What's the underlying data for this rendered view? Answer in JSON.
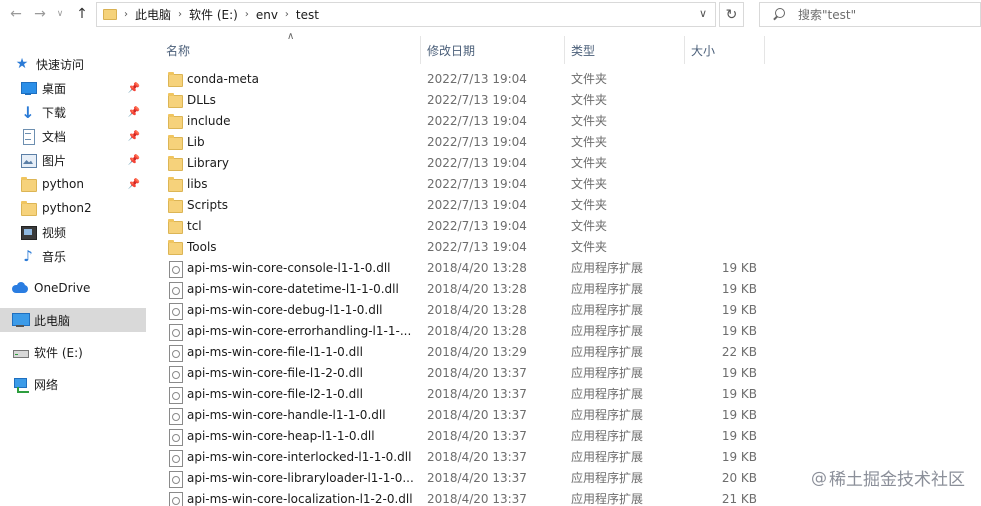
{
  "address": {
    "crumbs": [
      "此电脑",
      "软件 (E:)",
      "env",
      "test"
    ]
  },
  "search": {
    "placeholder": "搜索\"test\""
  },
  "sidebar": {
    "items": [
      {
        "label": "快速访问",
        "icon": "star-icon"
      },
      {
        "label": "桌面",
        "icon": "desktop-icon"
      },
      {
        "label": "下载",
        "icon": "download-icon"
      },
      {
        "label": "文档",
        "icon": "document-icon"
      },
      {
        "label": "图片",
        "icon": "picture-icon"
      },
      {
        "label": "python",
        "icon": "folder-icon"
      },
      {
        "label": "python2",
        "icon": "folder-icon"
      },
      {
        "label": "视频",
        "icon": "video-icon"
      },
      {
        "label": "音乐",
        "icon": "music-icon"
      },
      {
        "label": "OneDrive",
        "icon": "cloud-icon"
      },
      {
        "label": "此电脑",
        "icon": "computer-icon"
      },
      {
        "label": "软件 (E:)",
        "icon": "drive-icon"
      },
      {
        "label": "网络",
        "icon": "network-icon"
      }
    ]
  },
  "columns": {
    "name": "名称",
    "date": "修改日期",
    "type": "类型",
    "size": "大小"
  },
  "files": [
    {
      "name": "conda-meta",
      "date": "2022/7/13 19:04",
      "type": "文件夹",
      "size": "",
      "kind": "folder"
    },
    {
      "name": "DLLs",
      "date": "2022/7/13 19:04",
      "type": "文件夹",
      "size": "",
      "kind": "folder"
    },
    {
      "name": "include",
      "date": "2022/7/13 19:04",
      "type": "文件夹",
      "size": "",
      "kind": "folder"
    },
    {
      "name": "Lib",
      "date": "2022/7/13 19:04",
      "type": "文件夹",
      "size": "",
      "kind": "folder"
    },
    {
      "name": "Library",
      "date": "2022/7/13 19:04",
      "type": "文件夹",
      "size": "",
      "kind": "folder"
    },
    {
      "name": "libs",
      "date": "2022/7/13 19:04",
      "type": "文件夹",
      "size": "",
      "kind": "folder"
    },
    {
      "name": "Scripts",
      "date": "2022/7/13 19:04",
      "type": "文件夹",
      "size": "",
      "kind": "folder"
    },
    {
      "name": "tcl",
      "date": "2022/7/13 19:04",
      "type": "文件夹",
      "size": "",
      "kind": "folder"
    },
    {
      "name": "Tools",
      "date": "2022/7/13 19:04",
      "type": "文件夹",
      "size": "",
      "kind": "folder"
    },
    {
      "name": "api-ms-win-core-console-l1-1-0.dll",
      "date": "2018/4/20 13:28",
      "type": "应用程序扩展",
      "size": "19 KB",
      "kind": "dll"
    },
    {
      "name": "api-ms-win-core-datetime-l1-1-0.dll",
      "date": "2018/4/20 13:28",
      "type": "应用程序扩展",
      "size": "19 KB",
      "kind": "dll"
    },
    {
      "name": "api-ms-win-core-debug-l1-1-0.dll",
      "date": "2018/4/20 13:28",
      "type": "应用程序扩展",
      "size": "19 KB",
      "kind": "dll"
    },
    {
      "name": "api-ms-win-core-errorhandling-l1-1-...",
      "date": "2018/4/20 13:28",
      "type": "应用程序扩展",
      "size": "19 KB",
      "kind": "dll"
    },
    {
      "name": "api-ms-win-core-file-l1-1-0.dll",
      "date": "2018/4/20 13:29",
      "type": "应用程序扩展",
      "size": "22 KB",
      "kind": "dll"
    },
    {
      "name": "api-ms-win-core-file-l1-2-0.dll",
      "date": "2018/4/20 13:37",
      "type": "应用程序扩展",
      "size": "19 KB",
      "kind": "dll"
    },
    {
      "name": "api-ms-win-core-file-l2-1-0.dll",
      "date": "2018/4/20 13:37",
      "type": "应用程序扩展",
      "size": "19 KB",
      "kind": "dll"
    },
    {
      "name": "api-ms-win-core-handle-l1-1-0.dll",
      "date": "2018/4/20 13:37",
      "type": "应用程序扩展",
      "size": "19 KB",
      "kind": "dll"
    },
    {
      "name": "api-ms-win-core-heap-l1-1-0.dll",
      "date": "2018/4/20 13:37",
      "type": "应用程序扩展",
      "size": "19 KB",
      "kind": "dll"
    },
    {
      "name": "api-ms-win-core-interlocked-l1-1-0.dll",
      "date": "2018/4/20 13:37",
      "type": "应用程序扩展",
      "size": "19 KB",
      "kind": "dll"
    },
    {
      "name": "api-ms-win-core-libraryloader-l1-1-0....",
      "date": "2018/4/20 13:37",
      "type": "应用程序扩展",
      "size": "20 KB",
      "kind": "dll"
    },
    {
      "name": "api-ms-win-core-localization-l1-2-0.dll",
      "date": "2018/4/20 13:37",
      "type": "应用程序扩展",
      "size": "21 KB",
      "kind": "dll"
    }
  ],
  "watermark": {
    "text": "稀土掘金技术社区",
    "symbol": "@"
  },
  "colors": {
    "selected": "#d9d9d9",
    "header": "#4c607a",
    "folder": "#f6d27b"
  }
}
